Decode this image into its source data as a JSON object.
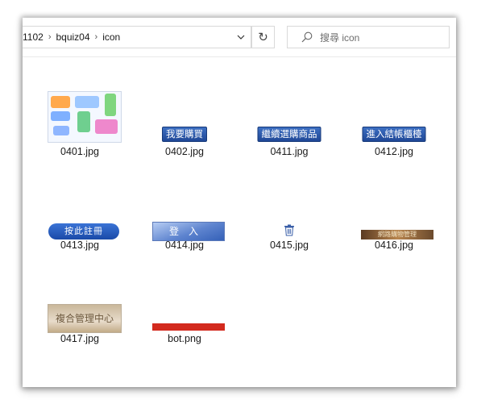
{
  "breadcrumb": [
    "1102",
    "bquiz04",
    "icon"
  ],
  "search": {
    "placeholder": "搜尋 icon"
  },
  "files": [
    {
      "name": "0401.jpg"
    },
    {
      "name": "0402.jpg",
      "thumb_text": "我要購買"
    },
    {
      "name": "0411.jpg",
      "thumb_text": "繼續選購商品"
    },
    {
      "name": "0412.jpg",
      "thumb_text": "進入結帳櫃檯"
    },
    {
      "name": "0413.jpg",
      "thumb_text": "按此註冊"
    },
    {
      "name": "0414.jpg",
      "thumb_text": "登入"
    },
    {
      "name": "0415.jpg"
    },
    {
      "name": "0416.jpg",
      "thumb_text": "網路購物管理"
    },
    {
      "name": "0417.jpg",
      "thumb_text": "複合管理中心"
    },
    {
      "name": "bot.png"
    }
  ],
  "icons": {
    "crumb_separator": "chevron-right-icon",
    "address_dropdown": "chevron-down-icon",
    "refresh": "refresh-icon",
    "search": "search-icon",
    "file_0415": "trash-icon"
  },
  "colors": {
    "bot_bar": "#d32a1e",
    "button_blue": "#1f4796"
  }
}
